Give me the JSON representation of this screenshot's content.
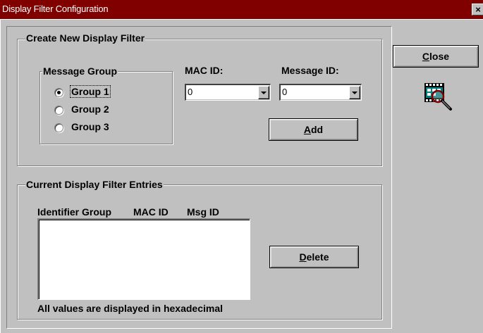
{
  "window": {
    "title": "Display Filter Configuration",
    "close_glyph": "×"
  },
  "create_group": {
    "label": "Create New Display Filter",
    "message_group": {
      "label": "Message Group",
      "options": [
        {
          "label": "Group 1",
          "checked": true
        },
        {
          "label": "Group 2",
          "checked": false
        },
        {
          "label": "Group 3",
          "checked": false
        }
      ]
    },
    "mac_id": {
      "label": "MAC ID:",
      "value": "0"
    },
    "message_id": {
      "label": "Message ID:",
      "value": "0"
    },
    "add_button": {
      "underline": "A",
      "rest": "dd"
    }
  },
  "current_group": {
    "label": "Current Display Filter Entries",
    "columns": {
      "identifier_group": "Identifier Group",
      "mac_id": "MAC ID",
      "msg_id": "Msg ID"
    },
    "entries": [],
    "delete_button": {
      "underline": "D",
      "rest": "elete"
    },
    "note": "All values are displayed in hexadecimal"
  },
  "close_button": {
    "underline": "C",
    "rest": "lose"
  },
  "icons": {
    "filter_icon": "magnifier-over-film-icon"
  }
}
